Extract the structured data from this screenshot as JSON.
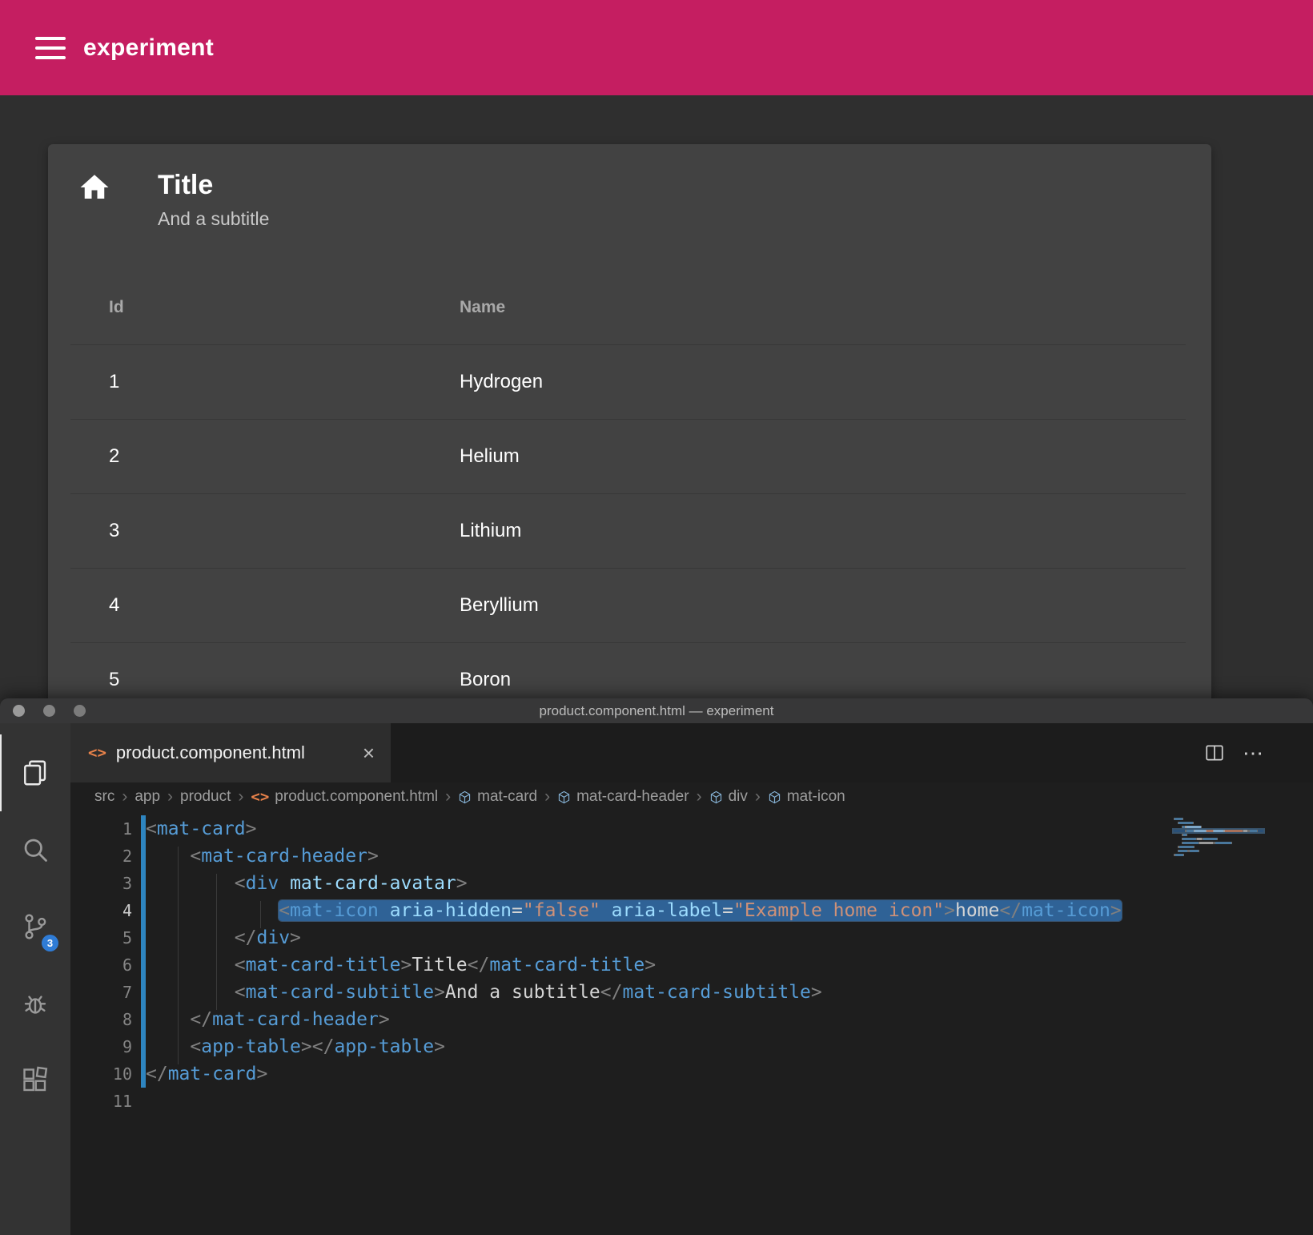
{
  "colors": {
    "accent": "#c51e61",
    "selection": "#2f6296",
    "badge": "#2f7cd6",
    "changebar": "#2e85c0",
    "tag": "#569cd6",
    "attr": "#9cdcfe",
    "string": "#ce9178",
    "punct": "#808080",
    "code-text": "#d4d4d4",
    "file-icon": "#e8824a",
    "symbol-icon": "#84b0d2"
  },
  "app": {
    "toolbar": {
      "title": "experiment"
    },
    "card": {
      "title": "Title",
      "subtitle": "And a subtitle",
      "table": {
        "columns": [
          "Id",
          "Name"
        ],
        "rows": [
          [
            "1",
            "Hydrogen"
          ],
          [
            "2",
            "Helium"
          ],
          [
            "3",
            "Lithium"
          ],
          [
            "4",
            "Beryllium"
          ],
          [
            "5",
            "Boron"
          ]
        ]
      }
    }
  },
  "vscode": {
    "window_title": "product.component.html — experiment",
    "tab": {
      "label": "product.component.html",
      "close": "×"
    },
    "activity": [
      {
        "name": "explorer"
      },
      {
        "name": "search"
      },
      {
        "name": "source-control",
        "badge": "3"
      },
      {
        "name": "debug"
      },
      {
        "name": "extensions"
      }
    ],
    "breadcrumb_separator": "›",
    "breadcrumbs": [
      {
        "label": "src"
      },
      {
        "label": "app"
      },
      {
        "label": "product"
      },
      {
        "label": "product.component.html",
        "icon": "code"
      },
      {
        "label": "mat-card",
        "icon": "symbol"
      },
      {
        "label": "mat-card-header",
        "icon": "symbol"
      },
      {
        "label": "div",
        "icon": "symbol"
      },
      {
        "label": "mat-icon",
        "icon": "symbol"
      }
    ],
    "editor": {
      "lines": [
        {
          "n": "1",
          "indent": 0,
          "changed": true,
          "selected": false,
          "tokens": [
            [
              "p",
              "<"
            ],
            [
              "tag",
              "mat-card"
            ],
            [
              "p",
              ">"
            ]
          ]
        },
        {
          "n": "2",
          "indent": 4,
          "changed": true,
          "selected": false,
          "tokens": [
            [
              "p",
              "<"
            ],
            [
              "tag",
              "mat-card-header"
            ],
            [
              "p",
              ">"
            ]
          ]
        },
        {
          "n": "3",
          "indent": 8,
          "changed": true,
          "selected": false,
          "tokens": [
            [
              "p",
              "<"
            ],
            [
              "tag",
              "div"
            ],
            [
              "txt",
              " "
            ],
            [
              "attr",
              "mat-card-avatar"
            ],
            [
              "p",
              ">"
            ]
          ]
        },
        {
          "n": "4",
          "indent": 12,
          "changed": true,
          "selected": true,
          "tokens": [
            [
              "p",
              "<"
            ],
            [
              "tag",
              "mat-icon"
            ],
            [
              "txt",
              " "
            ],
            [
              "attr",
              "aria-hidden"
            ],
            [
              "eq",
              "="
            ],
            [
              "str",
              "\"false\""
            ],
            [
              "txt",
              " "
            ],
            [
              "attr",
              "aria-label"
            ],
            [
              "eq",
              "="
            ],
            [
              "str",
              "\"Example home icon\""
            ],
            [
              "p",
              ">"
            ],
            [
              "txt",
              "home"
            ],
            [
              "p",
              "</"
            ],
            [
              "tag",
              "mat-icon"
            ],
            [
              "p",
              ">"
            ]
          ]
        },
        {
          "n": "5",
          "indent": 8,
          "changed": true,
          "selected": false,
          "tokens": [
            [
              "p",
              "</"
            ],
            [
              "tag",
              "div"
            ],
            [
              "p",
              ">"
            ]
          ]
        },
        {
          "n": "6",
          "indent": 8,
          "changed": true,
          "selected": false,
          "tokens": [
            [
              "p",
              "<"
            ],
            [
              "tag",
              "mat-card-title"
            ],
            [
              "p",
              ">"
            ],
            [
              "txt",
              "Title"
            ],
            [
              "p",
              "</"
            ],
            [
              "tag",
              "mat-card-title"
            ],
            [
              "p",
              ">"
            ]
          ]
        },
        {
          "n": "7",
          "indent": 8,
          "changed": true,
          "selected": false,
          "tokens": [
            [
              "p",
              "<"
            ],
            [
              "tag",
              "mat-card-subtitle"
            ],
            [
              "p",
              ">"
            ],
            [
              "txt",
              "And a subtitle"
            ],
            [
              "p",
              "</"
            ],
            [
              "tag",
              "mat-card-subtitle"
            ],
            [
              "p",
              ">"
            ]
          ]
        },
        {
          "n": "8",
          "indent": 4,
          "changed": true,
          "selected": false,
          "tokens": [
            [
              "p",
              "</"
            ],
            [
              "tag",
              "mat-card-header"
            ],
            [
              "p",
              ">"
            ]
          ]
        },
        {
          "n": "9",
          "indent": 4,
          "changed": true,
          "selected": false,
          "tokens": [
            [
              "p",
              "<"
            ],
            [
              "tag",
              "app-table"
            ],
            [
              "p",
              ">"
            ],
            [
              "p",
              "</"
            ],
            [
              "tag",
              "app-table"
            ],
            [
              "p",
              ">"
            ]
          ]
        },
        {
          "n": "10",
          "indent": 0,
          "changed": true,
          "selected": false,
          "tokens": [
            [
              "p",
              "</"
            ],
            [
              "tag",
              "mat-card"
            ],
            [
              "p",
              ">"
            ]
          ]
        },
        {
          "n": "11",
          "indent": 0,
          "changed": false,
          "selected": false,
          "tokens": []
        }
      ]
    }
  }
}
